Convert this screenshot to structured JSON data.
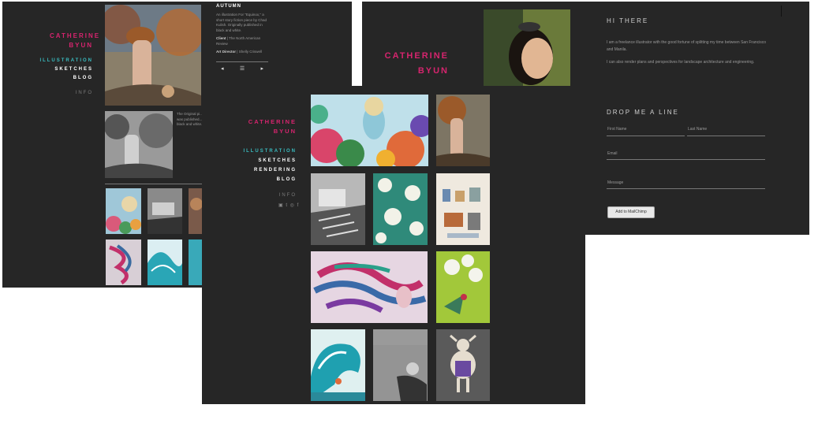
{
  "brand": {
    "first": "CATHERINE",
    "last": "BYUN"
  },
  "nav_small": [
    "ILLUSTRATION",
    "SKETCHES",
    "BLOG"
  ],
  "nav_small_info": "INFO",
  "nav_large": [
    "ILLUSTRATION",
    "SKETCHES",
    "RENDERING",
    "BLOG"
  ],
  "nav_large_info": "INFO",
  "social": "▣ t ◎ f",
  "detail": {
    "title": "AUTUMN",
    "desc": "An illustration For \"Equinox,\" a short story fiction piece by Chad Kulish. Originally published in black and white.",
    "client_label": "Client",
    "client_value": "The North American Review",
    "art_label": "Art Director",
    "art_value": "Shelly Criswell",
    "prev": "◂",
    "grid": "☰",
    "next": "▸",
    "note": "The Original pi... was published... black and white."
  },
  "about": {
    "heading": "HI THERE",
    "p1": "I am a freelance illustrator with the good fortune of splitting my time between San Francisco and Manila.",
    "p2": "I can also render plans and perspectives for landscape architecture and engineering.",
    "form_heading": "DROP ME A LINE",
    "first_name": "First Name",
    "last_name": "Last Name",
    "email": "Email",
    "message": "Message",
    "submit": "Add to MailChimp"
  },
  "colors": {
    "brand": "#d6246e",
    "active": "#39bcc0",
    "bg": "#262626"
  }
}
